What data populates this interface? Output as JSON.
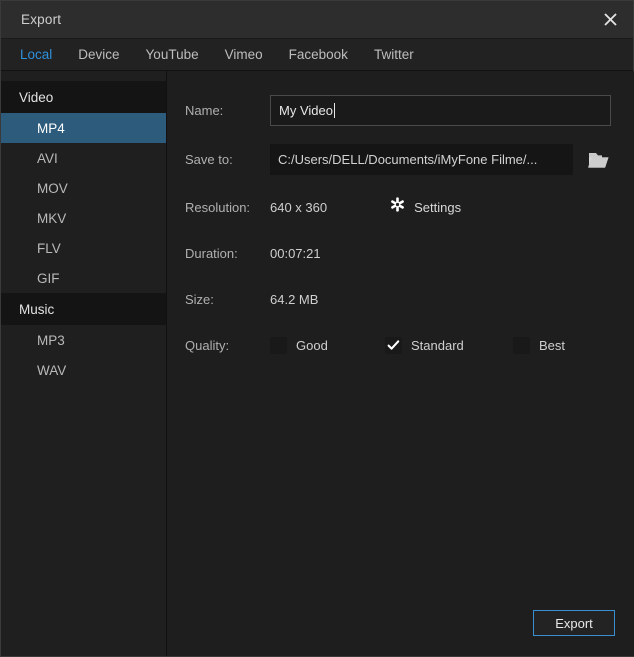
{
  "window": {
    "title": "Export",
    "close_icon": "close-icon"
  },
  "tabs": [
    {
      "label": "Local",
      "active": true
    },
    {
      "label": "Device",
      "active": false
    },
    {
      "label": "YouTube",
      "active": false
    },
    {
      "label": "Vimeo",
      "active": false
    },
    {
      "label": "Facebook",
      "active": false
    },
    {
      "label": "Twitter",
      "active": false
    }
  ],
  "sidebar": {
    "groups": [
      {
        "title": "Video",
        "items": [
          {
            "label": "MP4",
            "selected": true
          },
          {
            "label": "AVI",
            "selected": false
          },
          {
            "label": "MOV",
            "selected": false
          },
          {
            "label": "MKV",
            "selected": false
          },
          {
            "label": "FLV",
            "selected": false
          },
          {
            "label": "GIF",
            "selected": false
          }
        ]
      },
      {
        "title": "Music",
        "items": [
          {
            "label": "MP3",
            "selected": false
          },
          {
            "label": "WAV",
            "selected": false
          }
        ]
      }
    ]
  },
  "form": {
    "name": {
      "label": "Name:",
      "value": "My Video",
      "placeholder": "My Video"
    },
    "save_to": {
      "label": "Save to:",
      "value": "C:/Users/DELL/Documents/iMyFone Filme/...",
      "browse_icon": "folder-icon"
    },
    "resolution": {
      "label": "Resolution:",
      "value": "640 x 360",
      "settings_label": "Settings",
      "settings_icon": "gear-icon"
    },
    "duration": {
      "label": "Duration:",
      "value": "00:07:21"
    },
    "size": {
      "label": "Size:",
      "value": "64.2 MB"
    },
    "quality": {
      "label": "Quality:",
      "options": [
        {
          "label": "Good",
          "checked": false
        },
        {
          "label": "Standard",
          "checked": true
        },
        {
          "label": "Best",
          "checked": false
        }
      ]
    }
  },
  "footer": {
    "export_label": "Export"
  },
  "colors": {
    "accent_blue": "#2f90db",
    "selection_blue": "#2c5b7c",
    "button_border": "#3a8fd0",
    "window_bg": "#1e1e1e",
    "titlebar_bg": "#2d2d2d"
  }
}
